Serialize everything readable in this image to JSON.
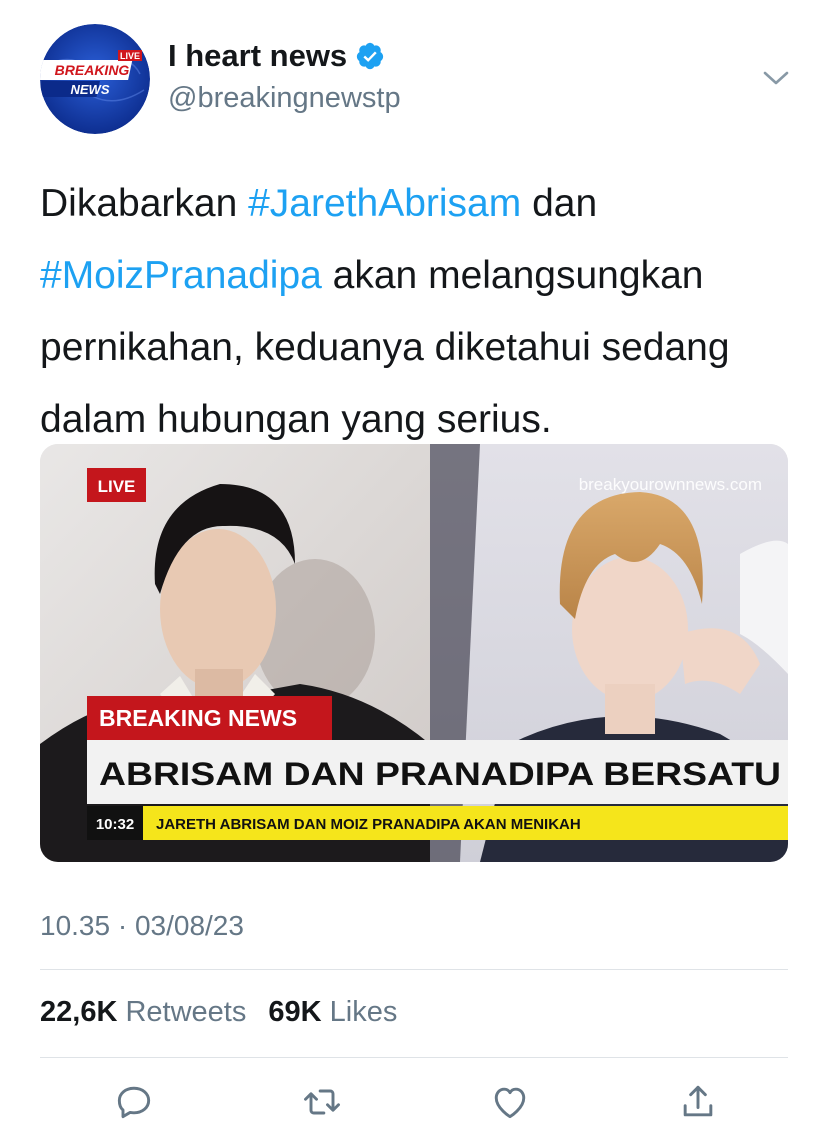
{
  "tweet": {
    "author": {
      "display_name": "I heart news",
      "handle": "@breakingnewstp",
      "verified": true,
      "avatar": {
        "line1": "BREAKING",
        "line2": "NEWS",
        "badge": "LIVE"
      }
    },
    "text": {
      "part1": "Dikabarkan ",
      "hashtag1": "#JarethAbrisam",
      "part2": " dan ",
      "hashtag2": "#MoizPranadipa",
      "part3": " akan melangsungkan pernikahan, keduanya diketahui sedang dalam hubungan yang serius."
    },
    "media": {
      "live_badge": "LIVE",
      "watermark": "breakyourownnews.com",
      "breaking_label": "BREAKING NEWS",
      "headline": "ABRISAM DAN PRANADIPA BERSATU",
      "ticker_time": "10:32",
      "ticker_text": "JARETH ABRISAM DAN MOIZ PRANADIPA AKAN MENIKAH"
    },
    "timestamp": "10.35 · 03/08/23",
    "stats": {
      "retweets_count": "22,6K",
      "retweets_label": "Retweets",
      "likes_count": "69K",
      "likes_label": "Likes"
    },
    "actions": [
      "reply-icon",
      "retweet-icon",
      "like-icon",
      "share-icon"
    ],
    "colors": {
      "link": "#1da1f2",
      "secondary": "#657786",
      "breaking_red": "#c4161c",
      "ticker_yellow": "#f5e51b"
    }
  }
}
